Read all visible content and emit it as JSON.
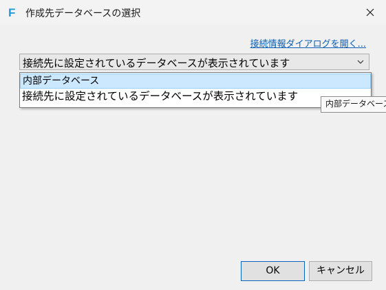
{
  "window": {
    "title": "作成先データベースの選択",
    "app_icon": "F",
    "close_icon": "close-icon"
  },
  "link": {
    "label": "接続情報ダイアログを開く..."
  },
  "combo": {
    "selected_value": "接続先に設定されているデータベースが表示されています"
  },
  "dropdown": {
    "options": [
      "内部データベース",
      "接続先に設定されているデータベースが表示されています"
    ],
    "selected_index": 0
  },
  "tooltip": {
    "text": "内部データベース"
  },
  "buttons": {
    "ok_label": "OK",
    "cancel_label": "キャンセル"
  },
  "colors": {
    "accent": "#0a64be",
    "link": "#0a5fb4",
    "selection_bg": "#cce8ff",
    "app_icon": "#1e9ad6"
  }
}
